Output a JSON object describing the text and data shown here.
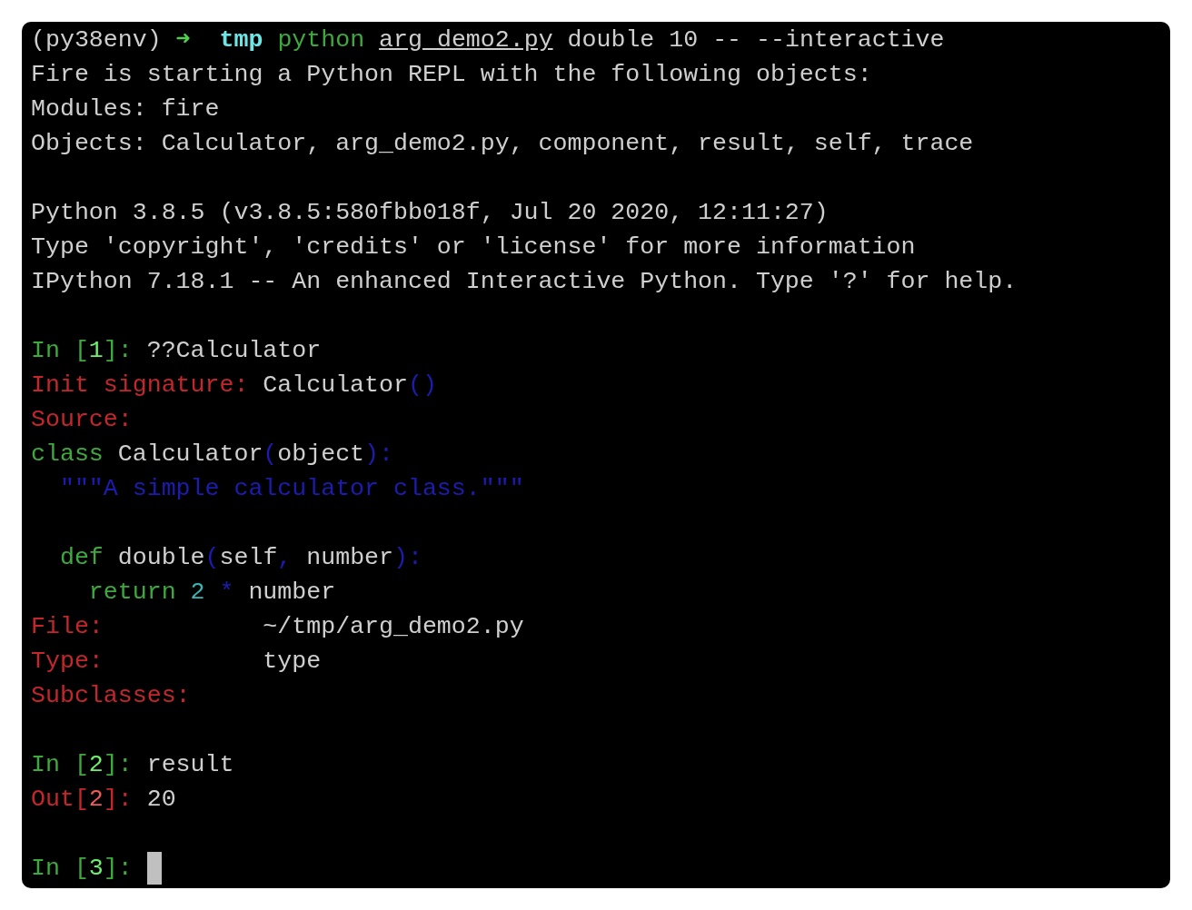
{
  "terminal": {
    "blocks": [
      {
        "lines": [
          {
            "segments": [
              {
                "kind": "plain",
                "text": "(py38env) "
              },
              {
                "kind": "arrow",
                "text": "➜  "
              },
              {
                "kind": "directory",
                "text": "tmp "
              },
              {
                "kind": "green",
                "text": "python "
              },
              {
                "kind": "underlined",
                "text": "arg_demo2.py"
              },
              {
                "kind": "plain",
                "text": " double 10 -- --interactive"
              }
            ]
          },
          {
            "segments": [
              {
                "kind": "plain",
                "text": "Fire is starting a Python REPL with the following objects:"
              }
            ]
          },
          {
            "segments": [
              {
                "kind": "plain",
                "text": "Modules: fire"
              }
            ]
          },
          {
            "segments": [
              {
                "kind": "plain",
                "text": "Objects: Calculator, arg_demo2.py, component, result, self, trace"
              }
            ]
          }
        ]
      },
      {
        "lines": [
          {
            "segments": [
              {
                "kind": "plain",
                "text": "Python 3.8.5 (v3.8.5:580fbb018f, Jul 20 2020, 12:11:27)"
              }
            ]
          },
          {
            "segments": [
              {
                "kind": "plain",
                "text": "Type 'copyright', 'credits' or 'license' for more information"
              }
            ]
          },
          {
            "segments": [
              {
                "kind": "plain",
                "text": "IPython 7.18.1 -- An enhanced Interactive Python. Type '?' for help."
              }
            ]
          }
        ]
      },
      {
        "lines": [
          {
            "segments": [
              {
                "kind": "green",
                "text": "In ["
              },
              {
                "kind": "bright_green",
                "text": "1"
              },
              {
                "kind": "green",
                "text": "]: "
              },
              {
                "kind": "plain",
                "text": "??Calculator"
              }
            ]
          },
          {
            "segments": [
              {
                "kind": "red",
                "text": "Init signature: "
              },
              {
                "kind": "plain",
                "text": "Calculator"
              },
              {
                "kind": "blue",
                "text": "()"
              }
            ]
          },
          {
            "segments": [
              {
                "kind": "red",
                "text": "Source:"
              }
            ]
          },
          {
            "segments": [
              {
                "kind": "green",
                "text": "class "
              },
              {
                "kind": "plain",
                "text": "Calculator"
              },
              {
                "kind": "blue",
                "text": "("
              },
              {
                "kind": "plain",
                "text": "object"
              },
              {
                "kind": "blue",
                "text": "):"
              }
            ]
          },
          {
            "segments": [
              {
                "kind": "blue",
                "text": "  \"\"\"A simple calculator class.\"\"\""
              }
            ]
          }
        ]
      },
      {
        "lines": [
          {
            "segments": [
              {
                "kind": "green",
                "text": "  def "
              },
              {
                "kind": "plain",
                "text": "double"
              },
              {
                "kind": "blue",
                "text": "("
              },
              {
                "kind": "plain",
                "text": "self"
              },
              {
                "kind": "blue",
                "text": ", "
              },
              {
                "kind": "plain",
                "text": "number"
              },
              {
                "kind": "blue",
                "text": "):"
              }
            ]
          },
          {
            "segments": [
              {
                "kind": "green",
                "text": "    return "
              },
              {
                "kind": "teal",
                "text": "2 "
              },
              {
                "kind": "blue",
                "text": "* "
              },
              {
                "kind": "plain",
                "text": "number"
              }
            ]
          },
          {
            "segments": [
              {
                "kind": "red",
                "text": "File:           "
              },
              {
                "kind": "plain",
                "text": "~/tmp/arg_demo2.py"
              }
            ]
          },
          {
            "segments": [
              {
                "kind": "red",
                "text": "Type:           "
              },
              {
                "kind": "plain",
                "text": "type"
              }
            ]
          },
          {
            "segments": [
              {
                "kind": "red",
                "text": "Subclasses:"
              }
            ]
          }
        ]
      },
      {
        "lines": [
          {
            "segments": [
              {
                "kind": "green",
                "text": "In ["
              },
              {
                "kind": "bright_green",
                "text": "2"
              },
              {
                "kind": "green",
                "text": "]: "
              },
              {
                "kind": "plain",
                "text": "result"
              }
            ]
          },
          {
            "segments": [
              {
                "kind": "red",
                "text": "Out["
              },
              {
                "kind": "bright_red",
                "text": "2"
              },
              {
                "kind": "red",
                "text": "]: "
              },
              {
                "kind": "plain",
                "text": "20"
              }
            ]
          }
        ]
      },
      {
        "lines": [
          {
            "cursor": true,
            "segments": [
              {
                "kind": "green",
                "text": "In ["
              },
              {
                "kind": "bright_green",
                "text": "3"
              },
              {
                "kind": "green",
                "text": "]: "
              }
            ]
          }
        ]
      }
    ]
  }
}
